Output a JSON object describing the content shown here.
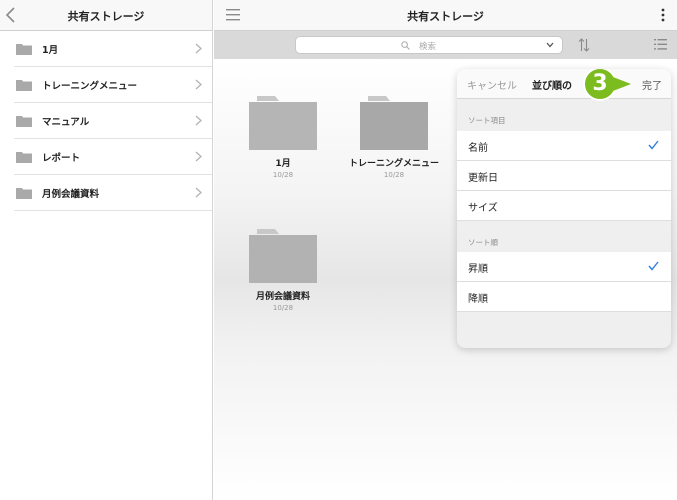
{
  "sidebar": {
    "title": "共有ストレージ",
    "items": [
      {
        "label": "1月"
      },
      {
        "label": "トレーニングメニュー"
      },
      {
        "label": "マニュアル"
      },
      {
        "label": "レポート"
      },
      {
        "label": "月例会議資料"
      }
    ]
  },
  "header": {
    "title": "共有ストレージ"
  },
  "search": {
    "placeholder": "検索"
  },
  "files": [
    {
      "name": "1月",
      "date": "10/28"
    },
    {
      "name": "トレーニングメニュー",
      "date": "10/28"
    },
    {
      "name": "月例会議資料",
      "date": "10/28"
    }
  ],
  "sort_popover": {
    "cancel_label": "キャンセル",
    "title": "並び順の",
    "done_label": "完了",
    "step_number": "3",
    "sort_field_header": "ソート項目",
    "sort_fields": [
      {
        "label": "名前",
        "selected": true
      },
      {
        "label": "更新日",
        "selected": false
      },
      {
        "label": "サイズ",
        "selected": false
      }
    ],
    "sort_order_header": "ソート順",
    "sort_orders": [
      {
        "label": "昇順",
        "selected": true
      },
      {
        "label": "降順",
        "selected": false
      }
    ]
  },
  "colors": {
    "accent": "#2f7de1",
    "badge": "#7dbc1f",
    "folder": "#b5b5b5"
  }
}
